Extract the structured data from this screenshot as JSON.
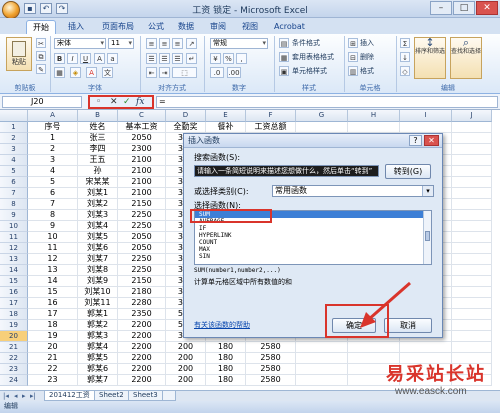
{
  "window": {
    "title": "工资 锁定 - Microsoft Excel",
    "minimize": "–",
    "maximize": "□",
    "close": "✕"
  },
  "tabs": [
    "开始",
    "插入",
    "页面布局",
    "公式",
    "数据",
    "审阅",
    "视图",
    "Acrobat"
  ],
  "ribbon": {
    "groups": [
      "剪贴板",
      "字体",
      "对齐方式",
      "数字",
      "样式",
      "单元格",
      "编辑"
    ],
    "paste": "粘贴",
    "font_name": "宋体",
    "font_size": "11",
    "number_format": "常规",
    "conditional_format": "条件格式",
    "table_format": "套用表格格式",
    "cell_style": "单元格样式",
    "insert": "插入",
    "delete": "删除",
    "format": "格式",
    "sort_filter": "排序和筛选",
    "find_select": "查找和选择",
    "bold": "B",
    "italic": "I",
    "underline": "U"
  },
  "formula_bar": {
    "name_box": "J20",
    "formula": "="
  },
  "columns": [
    "A",
    "B",
    "C",
    "D",
    "E",
    "F",
    "G",
    "H",
    "I",
    "J"
  ],
  "headers": [
    "序号",
    "姓名",
    "基本工资",
    "全勤奖",
    "餐补",
    "工资总额"
  ],
  "rows": [
    [
      "1",
      "张三",
      "2050",
      "300",
      "",
      ""
    ],
    [
      "2",
      "李四",
      "2300",
      "300",
      "",
      ""
    ],
    [
      "3",
      "王五",
      "2100",
      "300",
      "",
      ""
    ],
    [
      "4",
      "孙",
      "2100",
      "300",
      "",
      ""
    ],
    [
      "5",
      "宋某某",
      "2100",
      "300",
      "",
      ""
    ],
    [
      "6",
      "刘某1",
      "2100",
      "300",
      "",
      ""
    ],
    [
      "7",
      "刘某2",
      "2150",
      "300",
      "",
      ""
    ],
    [
      "8",
      "刘某3",
      "2250",
      "350",
      "",
      ""
    ],
    [
      "9",
      "刘某4",
      "2250",
      "350",
      "",
      ""
    ],
    [
      "10",
      "刘某5",
      "2050",
      "300",
      "",
      ""
    ],
    [
      "11",
      "刘某6",
      "2050",
      "300",
      "",
      ""
    ],
    [
      "12",
      "刘某7",
      "2250",
      "350",
      "",
      ""
    ],
    [
      "13",
      "刘某8",
      "2250",
      "350",
      "",
      ""
    ],
    [
      "14",
      "刘某9",
      "2150",
      "350",
      "",
      ""
    ],
    [
      "15",
      "刘某10",
      "2180",
      "350",
      "",
      ""
    ],
    [
      "16",
      "刘某11",
      "2280",
      "350",
      "",
      ""
    ],
    [
      "17",
      "郭某1",
      "2350",
      "500",
      "",
      ""
    ],
    [
      "18",
      "郭某2",
      "2200",
      "500",
      "",
      ""
    ],
    [
      "19",
      "郭某3",
      "2200",
      "300",
      "",
      ""
    ],
    [
      "20",
      "郭某4",
      "2200",
      "200",
      "180",
      "2580"
    ],
    [
      "21",
      "郭某5",
      "2200",
      "200",
      "180",
      "2580"
    ],
    [
      "22",
      "郭某6",
      "2200",
      "200",
      "180",
      "2580"
    ],
    [
      "23",
      "郭某7",
      "2200",
      "200",
      "180",
      "2580"
    ]
  ],
  "selected_row": "20",
  "sheet_tabs": [
    "201412工资",
    "Sheet2",
    "Sheet3"
  ],
  "status": "编辑",
  "dialog": {
    "title": "插入函数",
    "help": "?",
    "close": "✕",
    "search_label": "搜索函数(S):",
    "search_value": "请输入一条简短说明来描述您想做什么，然后单击“转到”",
    "goto_button": "转到(G)",
    "category_label": "或选择类别(C):",
    "category_value": "常用函数",
    "function_label": "选择函数(N):",
    "functions": [
      "SUM",
      "AVERAGE",
      "IF",
      "HYPERLINK",
      "COUNT",
      "MAX",
      "SIN"
    ],
    "selected_function": "SUM",
    "syntax": "SUM(number1,number2,...)",
    "description": "计算单元格区域中所有数值的和",
    "help_link": "有关该函数的帮助",
    "ok_button": "确定",
    "cancel_button": "取消"
  },
  "watermark": {
    "text": "易采站长站",
    "url": "www.easck.com"
  },
  "colors": {
    "accent": "#d9342b",
    "selection": "#3d7fd6",
    "ribbon": "#dbe8f7"
  }
}
